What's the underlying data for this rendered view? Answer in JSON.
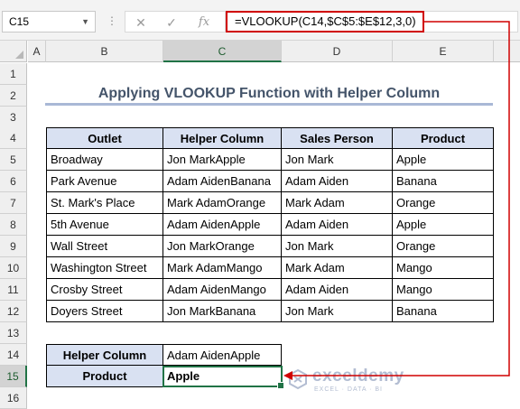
{
  "formula_bar": {
    "name_box": "C15",
    "formula": "=VLOOKUP(C14,$C$5:$E$12,3,0)",
    "cancel_icon": "✕",
    "enter_icon": "✓",
    "fx_label": "fx"
  },
  "columns": [
    "A",
    "B",
    "C",
    "D",
    "E"
  ],
  "rows": [
    "1",
    "2",
    "3",
    "4",
    "5",
    "6",
    "7",
    "8",
    "9",
    "10",
    "11",
    "12",
    "13",
    "14",
    "15",
    "16"
  ],
  "selected": {
    "column": "C",
    "row": "15"
  },
  "title": "Applying VLOOKUP Function with Helper Column",
  "table": {
    "headers": [
      "Outlet",
      "Helper Column",
      "Sales Person",
      "Product"
    ],
    "rows": [
      [
        "Broadway",
        "Jon MarkApple",
        "Jon Mark",
        "Apple"
      ],
      [
        "Park Avenue",
        "Adam AidenBanana",
        "Adam Aiden",
        "Banana"
      ],
      [
        "St. Mark's Place",
        "Mark AdamOrange",
        "Mark Adam",
        "Orange"
      ],
      [
        "5th Avenue",
        "Adam AidenApple",
        "Adam Aiden",
        "Apple"
      ],
      [
        "Wall Street",
        "Jon MarkOrange",
        "Jon Mark",
        "Orange"
      ],
      [
        "Washington Street",
        "Mark AdamMango",
        "Mark Adam",
        "Mango"
      ],
      [
        "Crosby Street",
        "Adam AidenMango",
        "Adam Aiden",
        "Mango"
      ],
      [
        "Doyers Street",
        "Jon MarkBanana",
        "Jon Mark",
        "Banana"
      ]
    ]
  },
  "lookup": {
    "helper_label": "Helper Column",
    "helper_value": "Adam AidenApple",
    "product_label": "Product",
    "product_value": "Apple"
  },
  "watermark": {
    "name": "exceldemy",
    "tagline": "EXCEL · DATA · BI"
  },
  "colors": {
    "header_fill": "#d9e1f2",
    "title_text": "#44546a",
    "annotation": "#d00000",
    "selection": "#217346"
  }
}
